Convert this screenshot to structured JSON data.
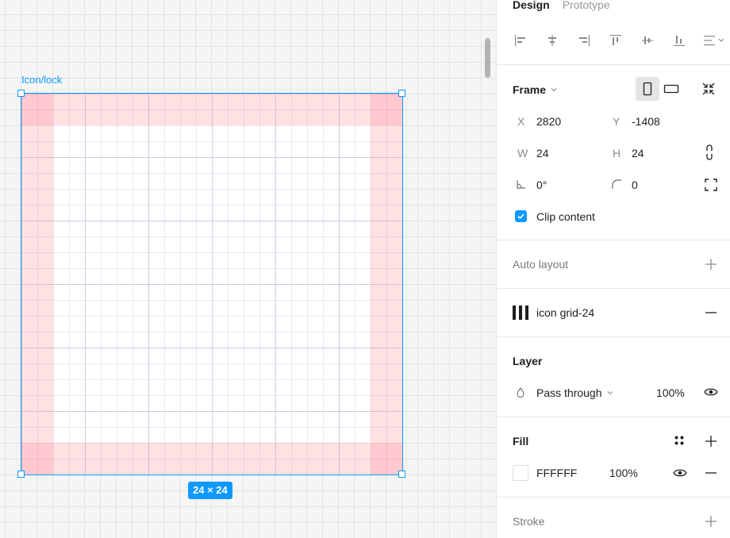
{
  "canvas": {
    "frame_label": "Icon/lock",
    "size_badge": "24 × 24"
  },
  "panel": {
    "tabs": [
      {
        "label": "Design",
        "active": true
      },
      {
        "label": "Prototype",
        "active": false
      }
    ],
    "frame": {
      "title": "Frame",
      "x_label": "X",
      "x_value": "2820",
      "y_label": "Y",
      "y_value": "-1408",
      "w_label": "W",
      "w_value": "24",
      "h_label": "H",
      "h_value": "24",
      "rotation_value": "0°",
      "radius_value": "0",
      "clip_content_label": "Clip content",
      "clip_content_checked": true
    },
    "auto_layout": {
      "title": "Auto layout"
    },
    "layout_grid": {
      "name": "icon grid-24"
    },
    "layer": {
      "title": "Layer",
      "blend_mode": "Pass through",
      "opacity": "100%"
    },
    "fill": {
      "title": "Fill",
      "hex": "FFFFFF",
      "opacity": "100%",
      "color": "#FFFFFF"
    },
    "stroke": {
      "title": "Stroke"
    }
  },
  "colors": {
    "accent": "#0d99ff",
    "padding_overlay": "#ffd6da"
  }
}
